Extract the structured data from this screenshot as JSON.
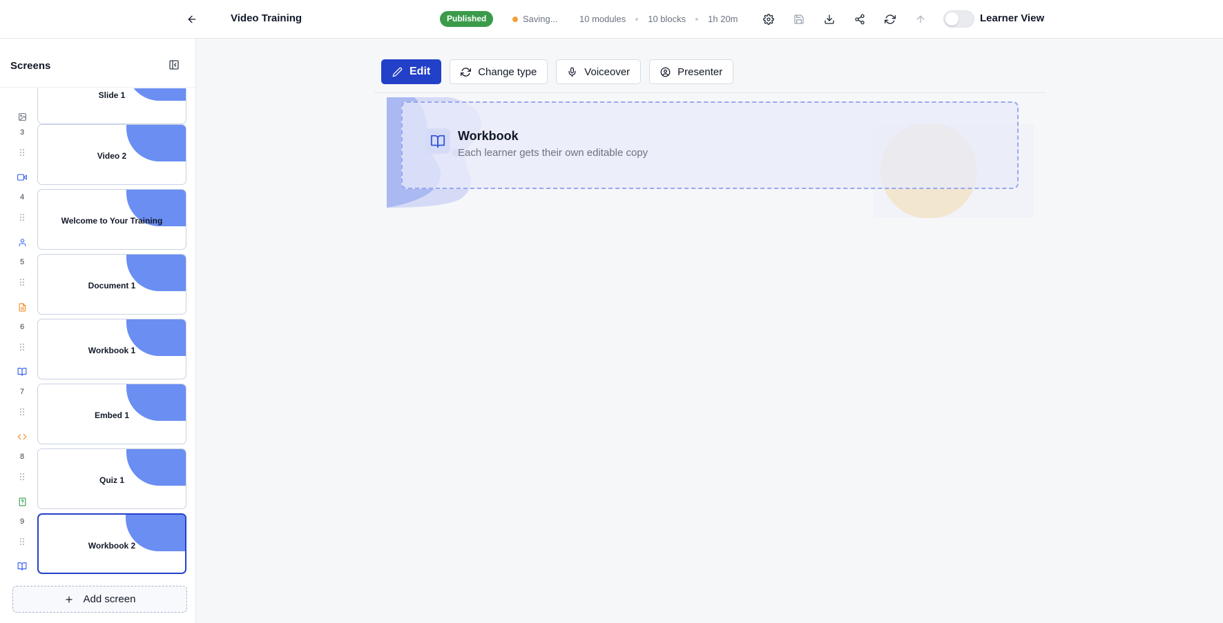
{
  "topbar": {
    "title": "Video Training",
    "status_badge": "Published",
    "saving_text": "Saving...",
    "stats": [
      "10 modules",
      "10 blocks",
      "1h 20m"
    ],
    "toggle_label": "Learner View",
    "toggle_on": false,
    "tool_icons": [
      "gear-icon",
      "save-icon",
      "download-icon",
      "share-icon",
      "refresh-icon",
      "arrow-up-icon"
    ]
  },
  "sidebar": {
    "title": "Screens",
    "add_screen_label": "Add screen",
    "screens": [
      {
        "number": "",
        "label": "Slide 1",
        "type_icon": "image-icon",
        "icon_color": "#6b7280"
      },
      {
        "number": "3",
        "label": "Video 2",
        "type_icon": "video-icon",
        "icon_color": "#3b63f0"
      },
      {
        "number": "4",
        "label": "Welcome to Your Training",
        "type_icon": "user-icon",
        "icon_color": "#3b63f0"
      },
      {
        "number": "5",
        "label": "Document 1",
        "type_icon": "document-icon",
        "icon_color": "#f08a24"
      },
      {
        "number": "6",
        "label": "Workbook 1",
        "type_icon": "book-icon",
        "icon_color": "#3b63f0"
      },
      {
        "number": "7",
        "label": "Embed 1",
        "type_icon": "code-icon",
        "icon_color": "#f08a24"
      },
      {
        "number": "8",
        "label": "Quiz 1",
        "type_icon": "quiz-icon",
        "icon_color": "#2f9a4a"
      },
      {
        "number": "9",
        "label": "Workbook 2",
        "type_icon": "book-icon",
        "icon_color": "#3b63f0",
        "selected": true
      }
    ]
  },
  "main": {
    "actions": [
      {
        "label": "Edit",
        "icon": "pencil-icon",
        "primary": true
      },
      {
        "label": "Change type",
        "icon": "refresh-icon"
      },
      {
        "label": "Voiceover",
        "icon": "microphone-icon"
      },
      {
        "label": "Presenter",
        "icon": "user-circle-icon"
      }
    ],
    "block": {
      "title": "Workbook",
      "subtitle": "Each learner gets their own editable copy",
      "icon": "book-icon"
    }
  },
  "colors": {
    "accent": "#2340c9",
    "published": "#3a9b4a",
    "saving_dot": "#f2a23a",
    "thumb_blob": "#6a8ef2"
  }
}
